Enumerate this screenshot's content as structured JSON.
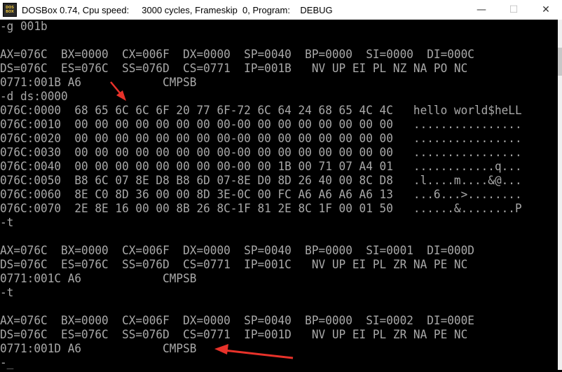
{
  "window": {
    "title": "DOSBox 0.74, Cpu speed:     3000 cycles, Frameskip  0, Program:    DEBUG",
    "icon_top": "DOS",
    "icon_bottom": "BOX",
    "minimize": "—",
    "maximize": "☐",
    "close": "✕"
  },
  "console": {
    "lines": [
      "-g 001b",
      "",
      "AX=076C  BX=0000  CX=006F  DX=0000  SP=0040  BP=0000  SI=0000  DI=000C",
      "DS=076C  ES=076C  SS=076D  CS=0771  IP=001B   NV UP EI PL NZ NA PO NC",
      "0771:001B A6            CMPSB",
      "-d ds:0000",
      "076C:0000  68 65 6C 6C 6F 20 77 6F-72 6C 64 24 68 65 4C 4C   hello world$heLL",
      "076C:0010  00 00 00 00 00 00 00 00-00 00 00 00 00 00 00 00   ................",
      "076C:0020  00 00 00 00 00 00 00 00-00 00 00 00 00 00 00 00   ................",
      "076C:0030  00 00 00 00 00 00 00 00-00 00 00 00 00 00 00 00   ................",
      "076C:0040  00 00 00 00 00 00 00 00-00 00 1B 00 71 07 A4 01   ............q...",
      "076C:0050  B8 6C 07 8E D8 B8 6D 07-8E D0 8D 26 40 00 8C D8   .l....m....&@...",
      "076C:0060  8E C0 8D 36 00 00 8D 3E-0C 00 FC A6 A6 A6 A6 13   ...6...>........",
      "076C:0070  2E 8E 16 00 00 8B 26 8C-1F 81 2E 8C 1F 00 01 50   ......&........P",
      "-t",
      "",
      "AX=076C  BX=0000  CX=006F  DX=0000  SP=0040  BP=0000  SI=0001  DI=000D",
      "DS=076C  ES=076C  SS=076D  CS=0771  IP=001C   NV UP EI PL ZR NA PE NC",
      "0771:001C A6            CMPSB",
      "-t",
      "",
      "AX=076C  BX=0000  CX=006F  DX=0000  SP=0040  BP=0000  SI=0002  DI=000E",
      "DS=076C  ES=076C  SS=076D  CS=0771  IP=001D   NV UP EI PL ZR NA PE NC",
      "0771:001D A6            CMPSB",
      "-_"
    ]
  },
  "colors": {
    "console_bg": "#000000",
    "console_text": "#a8a8a8",
    "annotation_arrow": "#e8322a"
  }
}
